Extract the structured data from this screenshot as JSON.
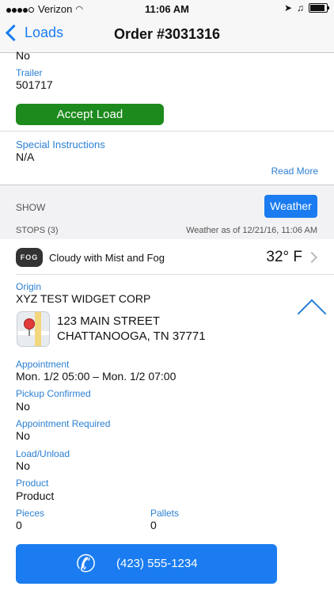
{
  "status_bar": {
    "carrier": "Verizon",
    "time": "11:06 AM",
    "battery_level": 0.9
  },
  "nav": {
    "back_label": "Loads",
    "title": "Order #3031316"
  },
  "details": {
    "prev_value": "No",
    "trailer_label": "Trailer",
    "trailer_value": "501717",
    "accept_label": "Accept Load",
    "accept_color": "#1d8a1d",
    "special_label": "Special Instructions",
    "special_value": "N/A",
    "read_more": "Read More"
  },
  "show": {
    "label": "SHOW",
    "weather_button": "Weather",
    "stops_label": "STOPS (3)",
    "weather_as_of": "Weather as of 12/21/16, 11:06 AM"
  },
  "weather": {
    "icon_text": "FOG",
    "description": "Cloudy with Mist and Fog",
    "temperature": "32° F"
  },
  "stop": {
    "origin_label": "Origin",
    "company": "XYZ TEST WIDGET CORP",
    "address_line1": "123 MAIN STREET",
    "address_line2": "CHATTANOOGA, TN 37771",
    "fields": [
      {
        "label": "Appointment",
        "value": "Mon. 1/2 05:00 – Mon. 1/2 07:00"
      },
      {
        "label": "Pickup Confirmed",
        "value": "No"
      },
      {
        "label": "Appointment Required",
        "value": "No"
      },
      {
        "label": "Load/Unload",
        "value": "No"
      },
      {
        "label": "Product",
        "value": "Product"
      }
    ],
    "pieces_label": "Pieces",
    "pieces_value": "0",
    "pallets_label": "Pallets",
    "pallets_value": "0",
    "phone": "(423) 555-1234"
  },
  "colors": {
    "accent": "#1a7cf0",
    "label_blue": "#2b7fd3"
  }
}
